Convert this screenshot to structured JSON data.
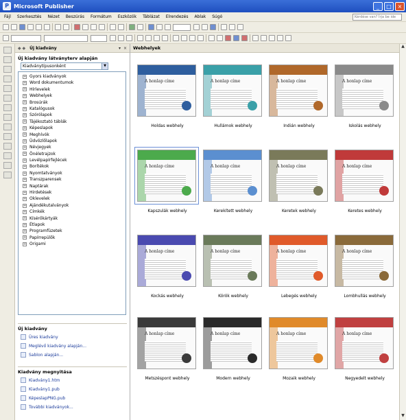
{
  "window": {
    "title": "Microsoft Publisher",
    "app_icon": "P"
  },
  "menu": [
    "Fájl",
    "Szerkesztés",
    "Nézet",
    "Beszúrás",
    "Formátum",
    "Eszközök",
    "Táblázat",
    "Elrendezés",
    "Ablak",
    "Súgó"
  ],
  "help_box_placeholder": "Kérdése van? Írja be ide",
  "task_pane": {
    "header_title": "Új kiadvány",
    "section_title": "Új kiadvány látványterv alapján",
    "combo_value": "Kiadványtípusonként",
    "categories": [
      "Gyors kiadványok",
      "Word dokumentumok",
      "Hírlevelek",
      "Webhelyek",
      "Brosúrák",
      "Katalógusok",
      "Szórólapok",
      "Tájékoztató táblák",
      "Képeslapok",
      "Meghívók",
      "Üdvözlőlapok",
      "Névjegyek",
      "Önéletrajzok",
      "Levélpapírfejlécek",
      "Borítékok",
      "Nyomtatványok",
      "Transzparensek",
      "Naptárak",
      "Hirdetések",
      "Oklevelek",
      "Ajándékutalványok",
      "Címkék",
      "Kísérőkártyák",
      "Étlapok",
      "Programfüzetek",
      "Papírrepülők",
      "Origami"
    ],
    "new_section": "Új kiadvány",
    "new_links": [
      "Üres kiadvány",
      "Meglévő kiadvány alapján...",
      "Sablon alapján..."
    ],
    "open_section": "Kiadvány megnyitása",
    "open_links": [
      "Kiadvány1.htm",
      "Kiadvány1.pub",
      "KépeslapPNG.pub",
      "További kiadványok..."
    ]
  },
  "main_pane": {
    "header": "Webhelyek",
    "thumb_heading": "A honlap címe",
    "templates": [
      {
        "name": "Holdas webhely",
        "color": "#2e5e9e"
      },
      {
        "name": "Hullámok webhely",
        "color": "#3aa0a8"
      },
      {
        "name": "Indián webhely",
        "color": "#b0682a"
      },
      {
        "name": "Iskolás webhely",
        "color": "#8a8a8a"
      },
      {
        "name": "Kapszulák webhely",
        "color": "#4caa4c",
        "selected": true
      },
      {
        "name": "Kerekített webhely",
        "color": "#5b8fd0"
      },
      {
        "name": "Keretek webhely",
        "color": "#7a7a5a"
      },
      {
        "name": "Keretes webhely",
        "color": "#c03a3a"
      },
      {
        "name": "Kockás webhely",
        "color": "#4a4ab0"
      },
      {
        "name": "Körök webhely",
        "color": "#6a7a5a"
      },
      {
        "name": "Lebegés webhely",
        "color": "#e05a2a"
      },
      {
        "name": "Lombhullás webhely",
        "color": "#8a6a3a"
      },
      {
        "name": "Metszéspont webhely",
        "color": "#3a3a3a"
      },
      {
        "name": "Modern webhely",
        "color": "#2a2a2a"
      },
      {
        "name": "Mozaik webhely",
        "color": "#e08a2a"
      },
      {
        "name": "Negyedelt webhely",
        "color": "#c04040"
      }
    ]
  }
}
